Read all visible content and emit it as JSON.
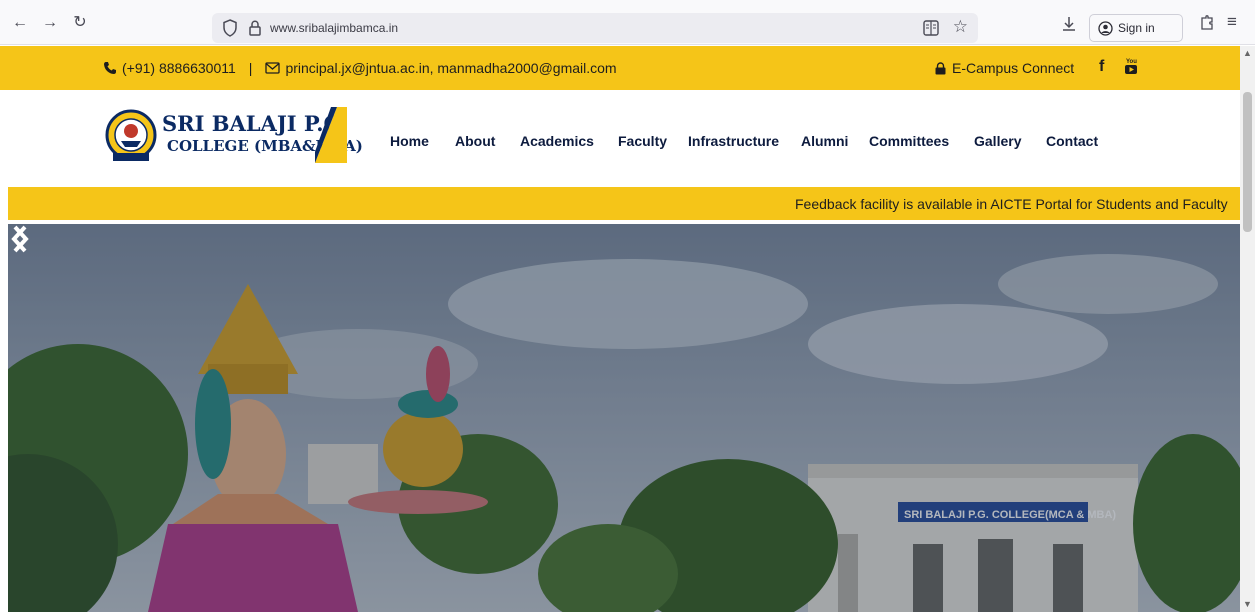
{
  "browser": {
    "url": "www.sribalajimbamca.in",
    "signin_label": "Sign in",
    "icons": [
      "back-icon",
      "forward-icon",
      "reload-icon",
      "shield-icon",
      "lock-icon",
      "reader-view-icon",
      "bookmark-star-icon",
      "download-icon",
      "account-icon",
      "extensions-icon",
      "menu-icon"
    ]
  },
  "topbar": {
    "phone": "(+91) 8886630011",
    "separator": "|",
    "emails": "principal.jx@jntua.ac.in, manmadha2000@gmail.com",
    "ecampus_label": "E-Campus Connect",
    "facebook_glyph": "f",
    "color": "#f5c518"
  },
  "logo": {
    "line1": "SRI BALAJI P.G",
    "line2": "COLLEGE (MBA&MCA)",
    "emblem_text": "Work is Worship",
    "color": "#0b2a63"
  },
  "nav": {
    "items": [
      "Home",
      "About",
      "Academics",
      "Faculty",
      "Infrastructure",
      "Alumni",
      "Committees",
      "Gallery",
      "Contact"
    ]
  },
  "ticker": {
    "text": "Feedback facility is available in AICTE Portal for Students and Faculty"
  },
  "hero": {
    "building_sign": "SRI BALAJI P.G. COLLEGE(MCA & MBA)",
    "prev_icon": "chevron-left-icon",
    "next_icon": "chevron-right-icon"
  }
}
